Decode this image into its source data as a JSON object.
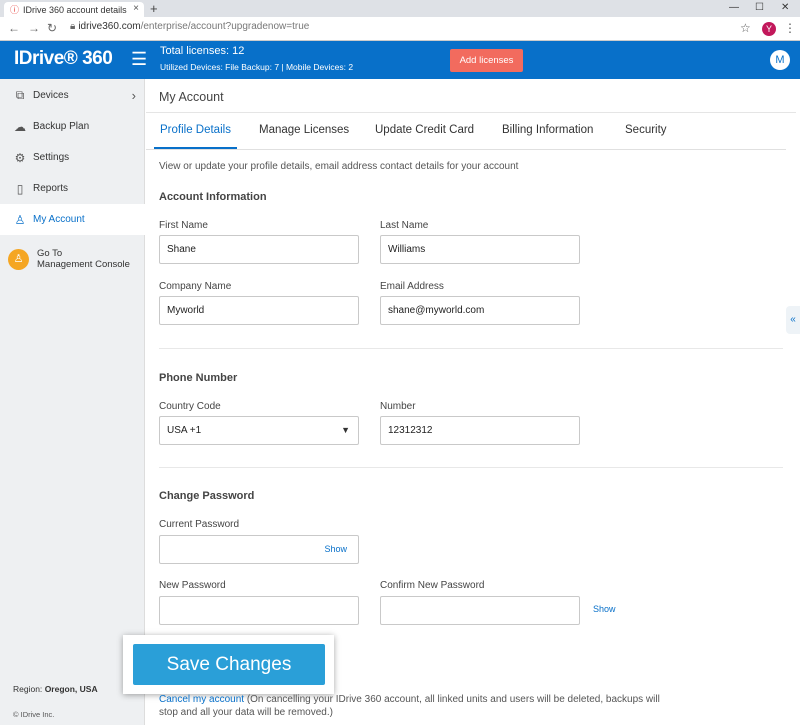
{
  "browser": {
    "tab_title": "IDrive 360 account details",
    "tab_close": "×",
    "new_tab": "+",
    "url_domain": "idrive360.com",
    "url_path": "/enterprise/account?upgradenow=true",
    "profile_initial": "Y",
    "minimize": "—",
    "maximize": "☐",
    "close": "✕"
  },
  "header": {
    "logo": "IDrive® 360",
    "total_licenses": "Total licenses: 12",
    "devices_summary": "Utilized Devices: File Backup: 7 |  Mobile Devices: 2",
    "add_licenses": "Add licenses",
    "avatar_initial": "M",
    "accent_color": "#0870c9"
  },
  "sidebar": {
    "items": [
      {
        "label": "Devices",
        "icon": "devices-icon"
      },
      {
        "label": "Backup Plan",
        "icon": "cloud-upload-icon"
      },
      {
        "label": "Settings",
        "icon": "gear-icon"
      },
      {
        "label": "Reports",
        "icon": "document-icon"
      },
      {
        "label": "My Account",
        "icon": "user-icon"
      }
    ],
    "goto_line1": "Go To",
    "goto_line2": "Management Console",
    "region_label": "Region:",
    "region_value": "Oregon, USA",
    "copyright": "© IDrive Inc."
  },
  "main": {
    "page_title": "My Account",
    "tabs": [
      "Profile Details",
      "Manage Licenses",
      "Update Credit Card",
      "Billing Information",
      "Security"
    ],
    "description": "View or update your profile details, email address contact details for your account",
    "account_section": "Account Information",
    "first_name_label": "First Name",
    "first_name": "Shane",
    "last_name_label": "Last Name",
    "last_name": "Williams",
    "company_label": "Company Name",
    "company": "Myworld",
    "email_label": "Email Address",
    "email": "shane@myworld.com",
    "phone_section": "Phone Number",
    "country_label": "Country Code",
    "country": "USA +1",
    "number_label": "Number",
    "number": "12312312",
    "password_section": "Change Password",
    "current_pw_label": "Current Password",
    "new_pw_label": "New Password",
    "confirm_pw_label": "Confirm New Password",
    "show": "Show",
    "save": "Save Changes",
    "cancel_link": "Cancel my account",
    "cancel_note": " (On cancelling your IDrive 360 account, all linked units and users will be deleted, backups will stop and all your data will be removed.)"
  }
}
